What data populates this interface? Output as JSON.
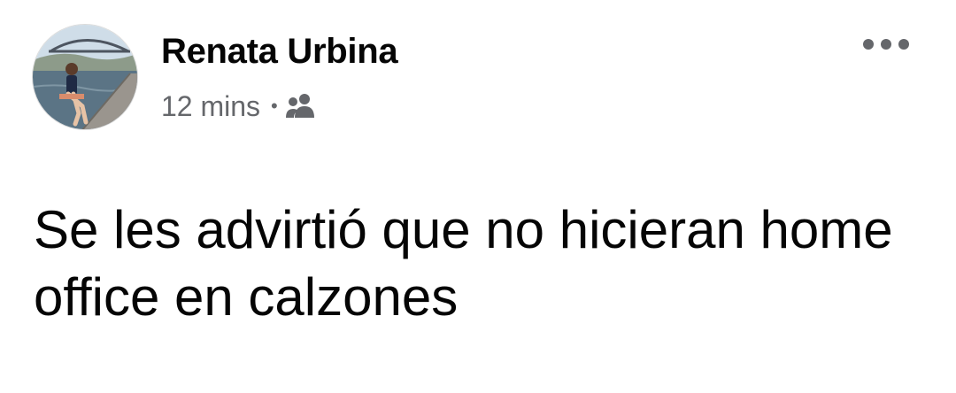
{
  "post": {
    "author": {
      "name": "Renata Urbina",
      "avatar": "profile-photo-woman-seated-by-river-bridge"
    },
    "timestamp": "12 mins",
    "separator": "•",
    "audience_icon": "friends-icon",
    "more_icon": "more-options-icon",
    "text": "Se les advirtió que no hicieran home office en calzones"
  },
  "colors": {
    "primary_text": "#050505",
    "secondary_text": "#65676b",
    "background": "#ffffff"
  }
}
